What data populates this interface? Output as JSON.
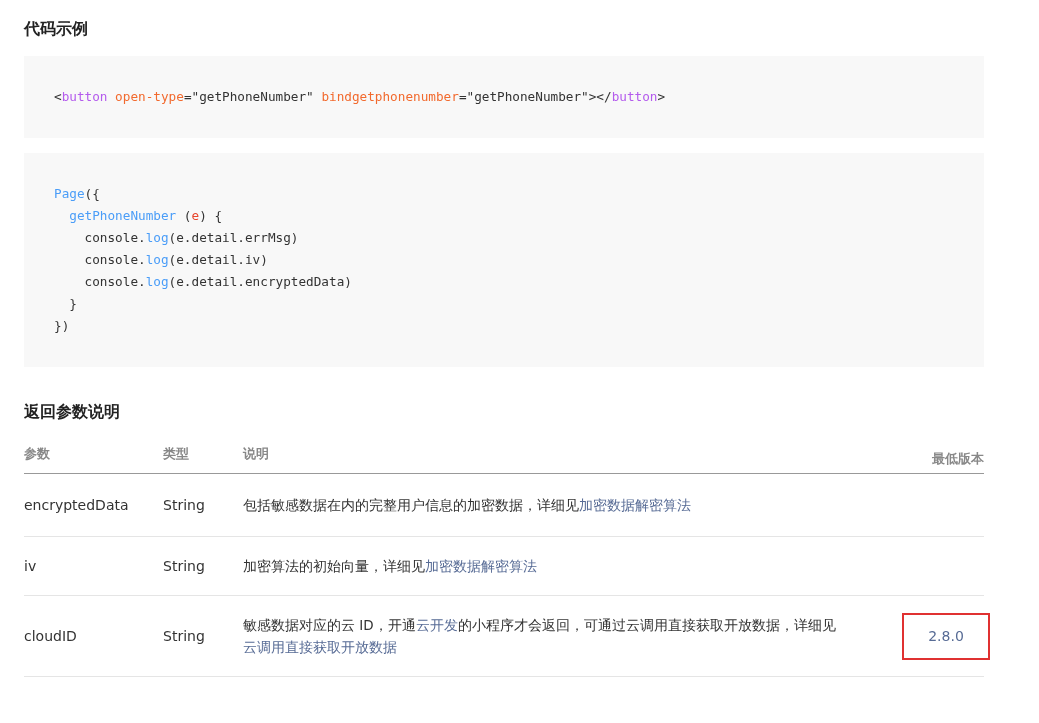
{
  "code_section": {
    "title": "代码示例",
    "blocks": [
      {
        "lines": [
          [
            {
              "text": "<",
              "kind": "plain"
            },
            {
              "text": "button",
              "kind": "tag"
            },
            {
              "text": " open-type",
              "kind": "attr"
            },
            {
              "text": "=\"getPhoneNumber\" ",
              "kind": "plain"
            },
            {
              "text": "bindgetphonenumber",
              "kind": "attr"
            },
            {
              "text": "=\"getPhoneNumber\"></",
              "kind": "plain"
            },
            {
              "text": "button",
              "kind": "tag"
            },
            {
              "text": ">",
              "kind": "plain"
            }
          ]
        ]
      },
      {
        "lines": [
          [
            {
              "text": "Page",
              "kind": "fn"
            },
            {
              "text": "({",
              "kind": "plain"
            }
          ],
          [
            {
              "text": "  getPhoneNumber",
              "kind": "fn"
            },
            {
              "text": " (",
              "kind": "plain"
            },
            {
              "text": "e",
              "kind": "param"
            },
            {
              "text": ") {",
              "kind": "plain"
            }
          ],
          [
            {
              "text": "    console.",
              "kind": "plain"
            },
            {
              "text": "log",
              "kind": "fn"
            },
            {
              "text": "(e.detail.errMsg)",
              "kind": "plain"
            }
          ],
          [
            {
              "text": "    console.",
              "kind": "plain"
            },
            {
              "text": "log",
              "kind": "fn"
            },
            {
              "text": "(e.detail.iv)",
              "kind": "plain"
            }
          ],
          [
            {
              "text": "    console.",
              "kind": "plain"
            },
            {
              "text": "log",
              "kind": "fn"
            },
            {
              "text": "(e.detail.encryptedData)",
              "kind": "plain"
            }
          ],
          [
            {
              "text": "  }",
              "kind": "plain"
            }
          ],
          [
            {
              "text": "})",
              "kind": "plain"
            }
          ]
        ]
      }
    ]
  },
  "params_section": {
    "title": "返回参数说明",
    "table": {
      "columns": [
        "参数",
        "类型",
        "说明",
        "最低版本"
      ],
      "rows": [
        {
          "name": "encryptedData",
          "type": "String",
          "description": [
            {
              "text": "包括敏感数据在内的完整用户信息的加密数据，详细见",
              "kind": "text"
            },
            {
              "text": "加密数据解密算法",
              "kind": "link"
            }
          ],
          "highlighted": false
        },
        {
          "name": "iv",
          "type": "String",
          "description": [
            {
              "text": "加密算法的初始向量，详细见",
              "kind": "text"
            },
            {
              "text": "加密数据解密算法",
              "kind": "link"
            }
          ],
          "highlighted": false
        },
        {
          "name": "cloudID",
          "type": "String",
          "description": [
            {
              "text": "敏感数据对应的云 ID，开通",
              "kind": "text"
            },
            {
              "text": "云开发",
              "kind": "link"
            },
            {
              "text": "的小程序才会返回，可通过云调用直接获取开放数据，详细见",
              "kind": "text"
            },
            {
              "text": "云调用直接获取开放数据",
              "kind": "link"
            }
          ],
          "version": "2.8.0",
          "highlighted": true
        }
      ]
    }
  }
}
